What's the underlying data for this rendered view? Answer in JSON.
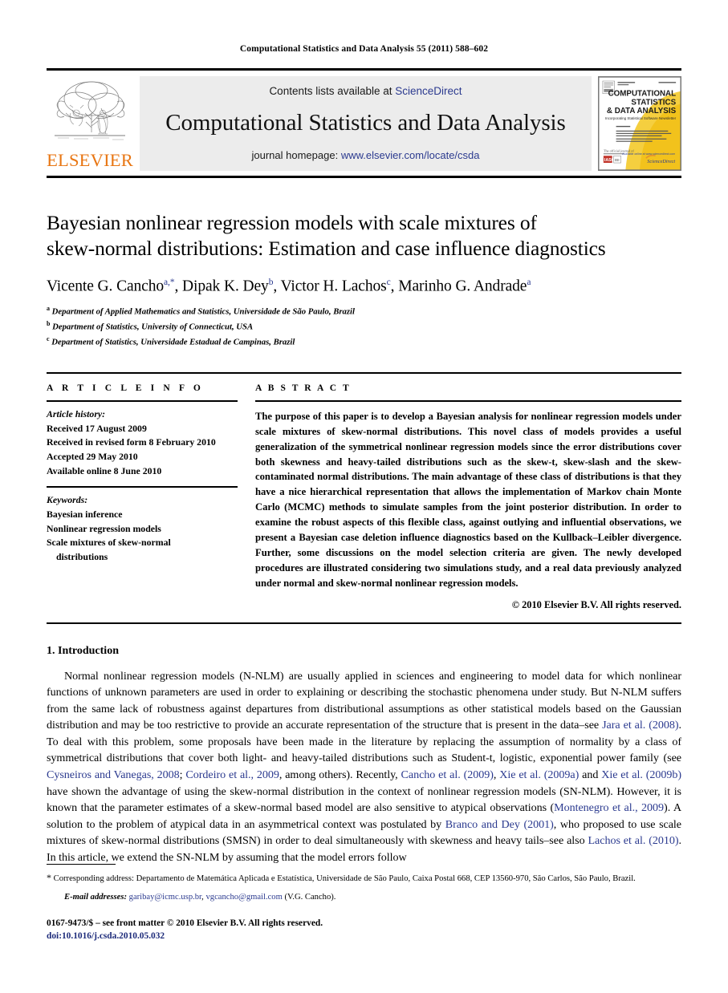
{
  "running_head": "Computational Statistics and Data Analysis 55 (2011) 588–602",
  "masthead": {
    "publisher_name": "ELSEVIER",
    "contents_prefix": "Contents lists available at ",
    "contents_link": "ScienceDirect",
    "journal_title": "Computational Statistics and Data Analysis",
    "homepage_prefix": "journal homepage: ",
    "homepage_link": "www.elsevier.com/locate/csda",
    "cover": {
      "line1": "COMPUTATIONAL",
      "line2": "STATISTICS",
      "line3": "& DATA ANALYSIS",
      "line4": "Incorporating  Statistical Software Newsletter",
      "sciencedirect": "ScienceDirect"
    },
    "accent_orange": "#E87613",
    "link_blue": "#2b3a8f",
    "band_gray": "#ececec"
  },
  "article": {
    "title_line1": "Bayesian nonlinear regression models with scale mixtures of",
    "title_line2": "skew-normal distributions: Estimation and case influence diagnostics",
    "authors": [
      {
        "name": "Vicente G. Cancho",
        "sup": "a,*"
      },
      {
        "name": "Dipak K. Dey",
        "sup": "b"
      },
      {
        "name": "Victor H. Lachos",
        "sup": "c"
      },
      {
        "name": "Marinho G. Andrade",
        "sup": "a"
      }
    ],
    "affiliations": [
      {
        "mark": "a",
        "text": "Department of Applied Mathematics and Statistics, Universidade de São Paulo, Brazil"
      },
      {
        "mark": "b",
        "text": "Department of Statistics, University of Connecticut, USA"
      },
      {
        "mark": "c",
        "text": "Department of Statistics, Universidade Estadual de Campinas, Brazil"
      }
    ]
  },
  "article_info": {
    "label": "A R T I C L E    I N F O",
    "history_label": "Article history:",
    "history": [
      "Received 17 August 2009",
      "Received in revised form 8 February 2010",
      "Accepted 29 May 2010",
      "Available online 8 June 2010"
    ],
    "keywords_label": "Keywords:",
    "keywords": [
      "Bayesian inference",
      "Nonlinear regression models",
      "Scale mixtures of skew-normal"
    ],
    "keywords_continuation": "distributions"
  },
  "abstract": {
    "label": "A B S T R A C T",
    "text": "The purpose of this paper is to develop a Bayesian analysis for nonlinear regression models under scale mixtures of skew-normal distributions. This novel class of models provides a useful generalization of the symmetrical nonlinear regression models since the error distributions cover both skewness and heavy-tailed distributions such as the skew-t, skew-slash and the skew-contaminated normal distributions. The main advantage of these class of distributions is that they have a nice hierarchical representation that allows the implementation of Markov chain Monte Carlo (MCMC) methods to simulate samples from the joint posterior distribution. In order to examine the robust aspects of this flexible class, against outlying and influential observations, we present a Bayesian case deletion influence diagnostics based on the Kullback–Leibler divergence. Further, some discussions on the model selection criteria are given. The newly developed procedures are illustrated considering two simulations study, and a real data previously analyzed under normal and skew-normal nonlinear regression models.",
    "copyright": "© 2010 Elsevier B.V. All rights reserved."
  },
  "body": {
    "section_heading": "1.  Introduction",
    "paragraph_segments": [
      {
        "type": "text",
        "value": "Normal nonlinear regression models (N-NLM) are usually applied in sciences and engineering to model data for which nonlinear functions of unknown parameters are used in order to explaining or describing the stochastic phenomena under study. But N-NLM suffers from the same lack of robustness against departures from distributional assumptions as other statistical models based on the Gaussian distribution and may be too restrictive to provide an accurate representation of the structure that is present in the data–see "
      },
      {
        "type": "cite",
        "value": "Jara et al. (2008)"
      },
      {
        "type": "text",
        "value": ". To deal with this problem, some proposals have been made in the literature by replacing the assumption of normality by a class of symmetrical distributions that cover both light- and heavy-tailed distributions such as Student-t, logistic, exponential power family (see "
      },
      {
        "type": "cite",
        "value": "Cysneiros and Vanegas, 2008"
      },
      {
        "type": "text",
        "value": "; "
      },
      {
        "type": "cite",
        "value": "Cordeiro et al., 2009"
      },
      {
        "type": "text",
        "value": ", among others). Recently, "
      },
      {
        "type": "cite",
        "value": "Cancho et al. (2009)"
      },
      {
        "type": "text",
        "value": ", "
      },
      {
        "type": "cite",
        "value": "Xie et al. (2009a)"
      },
      {
        "type": "text",
        "value": " and "
      },
      {
        "type": "cite",
        "value": "Xie et al. (2009b)"
      },
      {
        "type": "text",
        "value": " have shown the advantage of using the skew-normal distribution in the context of nonlinear regression models (SN-NLM). However, it is known that the parameter estimates of a skew-normal based model are also sensitive to atypical observations ("
      },
      {
        "type": "cite",
        "value": "Montenegro et al., 2009"
      },
      {
        "type": "text",
        "value": "). A solution to the problem of atypical data in an asymmetrical context was postulated by "
      },
      {
        "type": "cite",
        "value": "Branco and Dey (2001)"
      },
      {
        "type": "text",
        "value": ", who proposed to use scale mixtures of skew-normal distributions (SMSN) in order to deal simultaneously with skewness and heavy tails–see also "
      },
      {
        "type": "cite",
        "value": "Lachos et al. (2010)"
      },
      {
        "type": "text",
        "value": ". In this article, we extend the SN-NLM by assuming that the model errors follow"
      }
    ]
  },
  "footnotes": {
    "corresponding": "Corresponding address: Departamento de Matemática Aplicada e Estatística, Universidade de São Paulo, Caixa Postal 668, CEP 13560-970, São Carlos, São Paulo, Brazil.",
    "email_label": "E-mail addresses:",
    "email_1": "garibay@icmc.usp.br",
    "email_2": "vgcancho@gmail.com",
    "email_attrib": "(V.G. Cancho).",
    "issn_line": "0167-9473/$ – see front matter © 2010 Elsevier B.V. All rights reserved.",
    "doi_line": "doi:10.1016/j.csda.2010.05.032"
  }
}
